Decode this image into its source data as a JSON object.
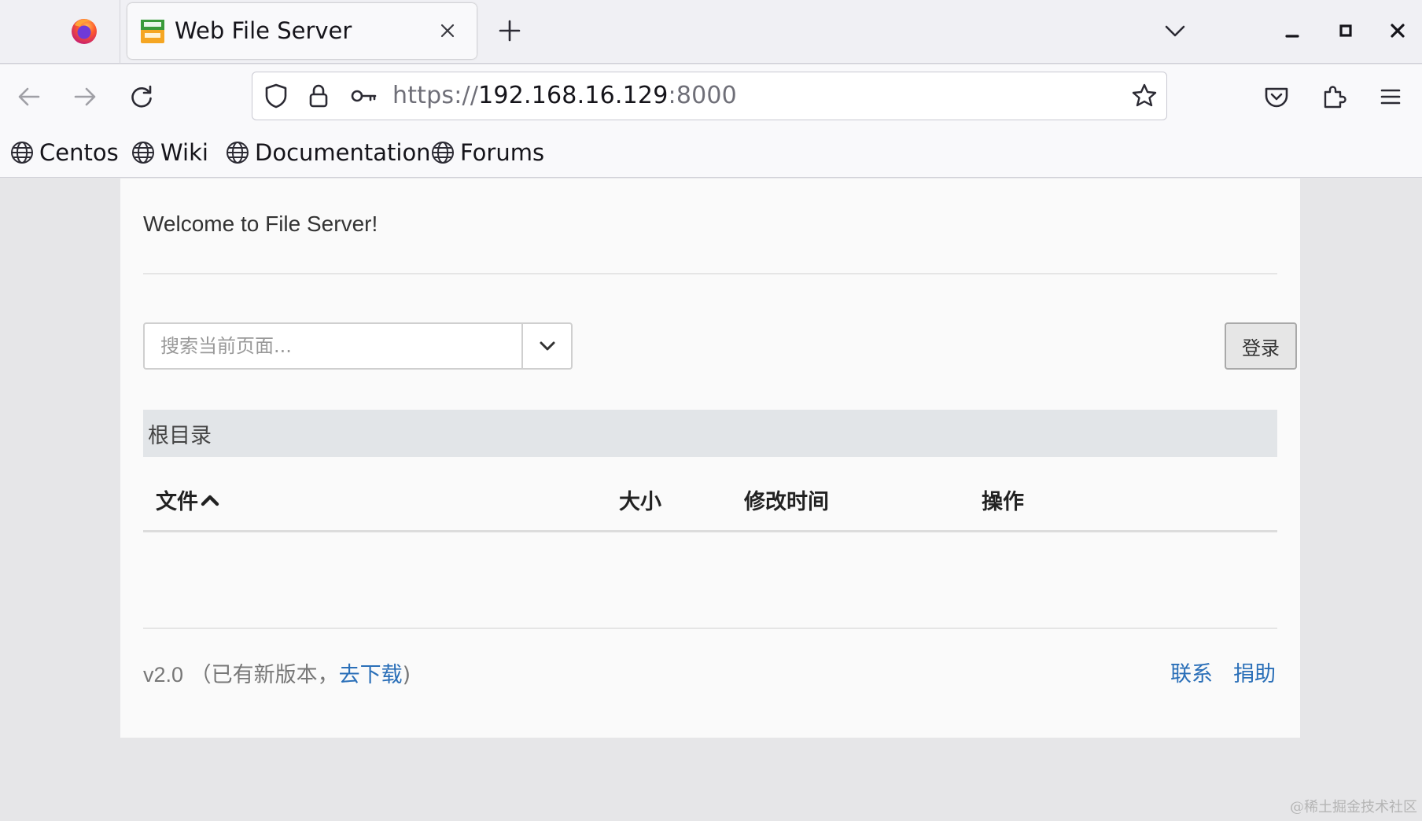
{
  "browser": {
    "tab": {
      "title": "Web File Server",
      "favicon": "cute-me-favicon"
    },
    "url": {
      "scheme": "https://",
      "host": "192.168.16.129",
      "port": ":8000"
    },
    "bookmarks": [
      {
        "label": "Centos",
        "icon": "globe-icon"
      },
      {
        "label": "Wiki",
        "icon": "globe-icon"
      },
      {
        "label": "Documentation",
        "icon": "globe-icon"
      },
      {
        "label": "Forums",
        "icon": "globe-icon"
      }
    ]
  },
  "page": {
    "welcome": "Welcome to File Server!",
    "search": {
      "placeholder": "搜索当前页面..."
    },
    "login_label": "登录",
    "breadcrumb": "根目录",
    "table": {
      "headers": {
        "file": "文件",
        "size": "大小",
        "mtime": "修改时间",
        "actions": "操作"
      },
      "sort": {
        "column": "file",
        "direction": "ascending"
      },
      "rows": []
    },
    "footer": {
      "version": "v2.0",
      "update_prefix": "（已有新版本，",
      "update_link": "去下载",
      "update_suffix": ")",
      "links": [
        "联系",
        "捐助"
      ]
    }
  },
  "watermark": "@稀土掘金技术社区",
  "colors": {
    "link": "#2a6fb8",
    "breadcrumb_bg": "#e2e5e8",
    "login_bg": "#e6e6e6"
  }
}
